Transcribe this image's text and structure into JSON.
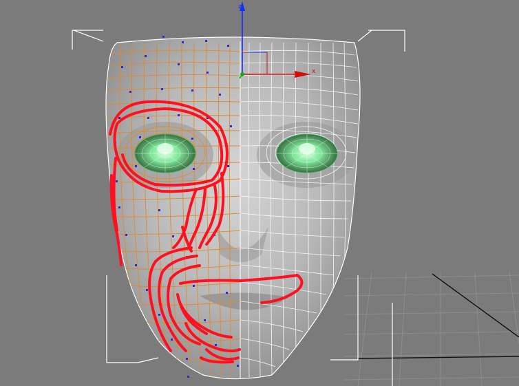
{
  "viewport": {
    "background": "#7b7b7b",
    "grid_color": "#8e8e8e",
    "grid_axis_color": "#111111"
  },
  "scene": {
    "object": "head-mesh",
    "selection_color": "#e08a2a",
    "wire_color": "#ffffff",
    "vertex_color": "#2a2ad8",
    "eye_color": "#9ef0b0",
    "paint_color": "#ff1020",
    "bbox_color": "#ffffff"
  },
  "gizmo": {
    "x_label": "x",
    "y_label": "y",
    "z_label": "z",
    "x_color": "#d01010",
    "y_color": "#10b010",
    "z_color": "#1030ff"
  }
}
